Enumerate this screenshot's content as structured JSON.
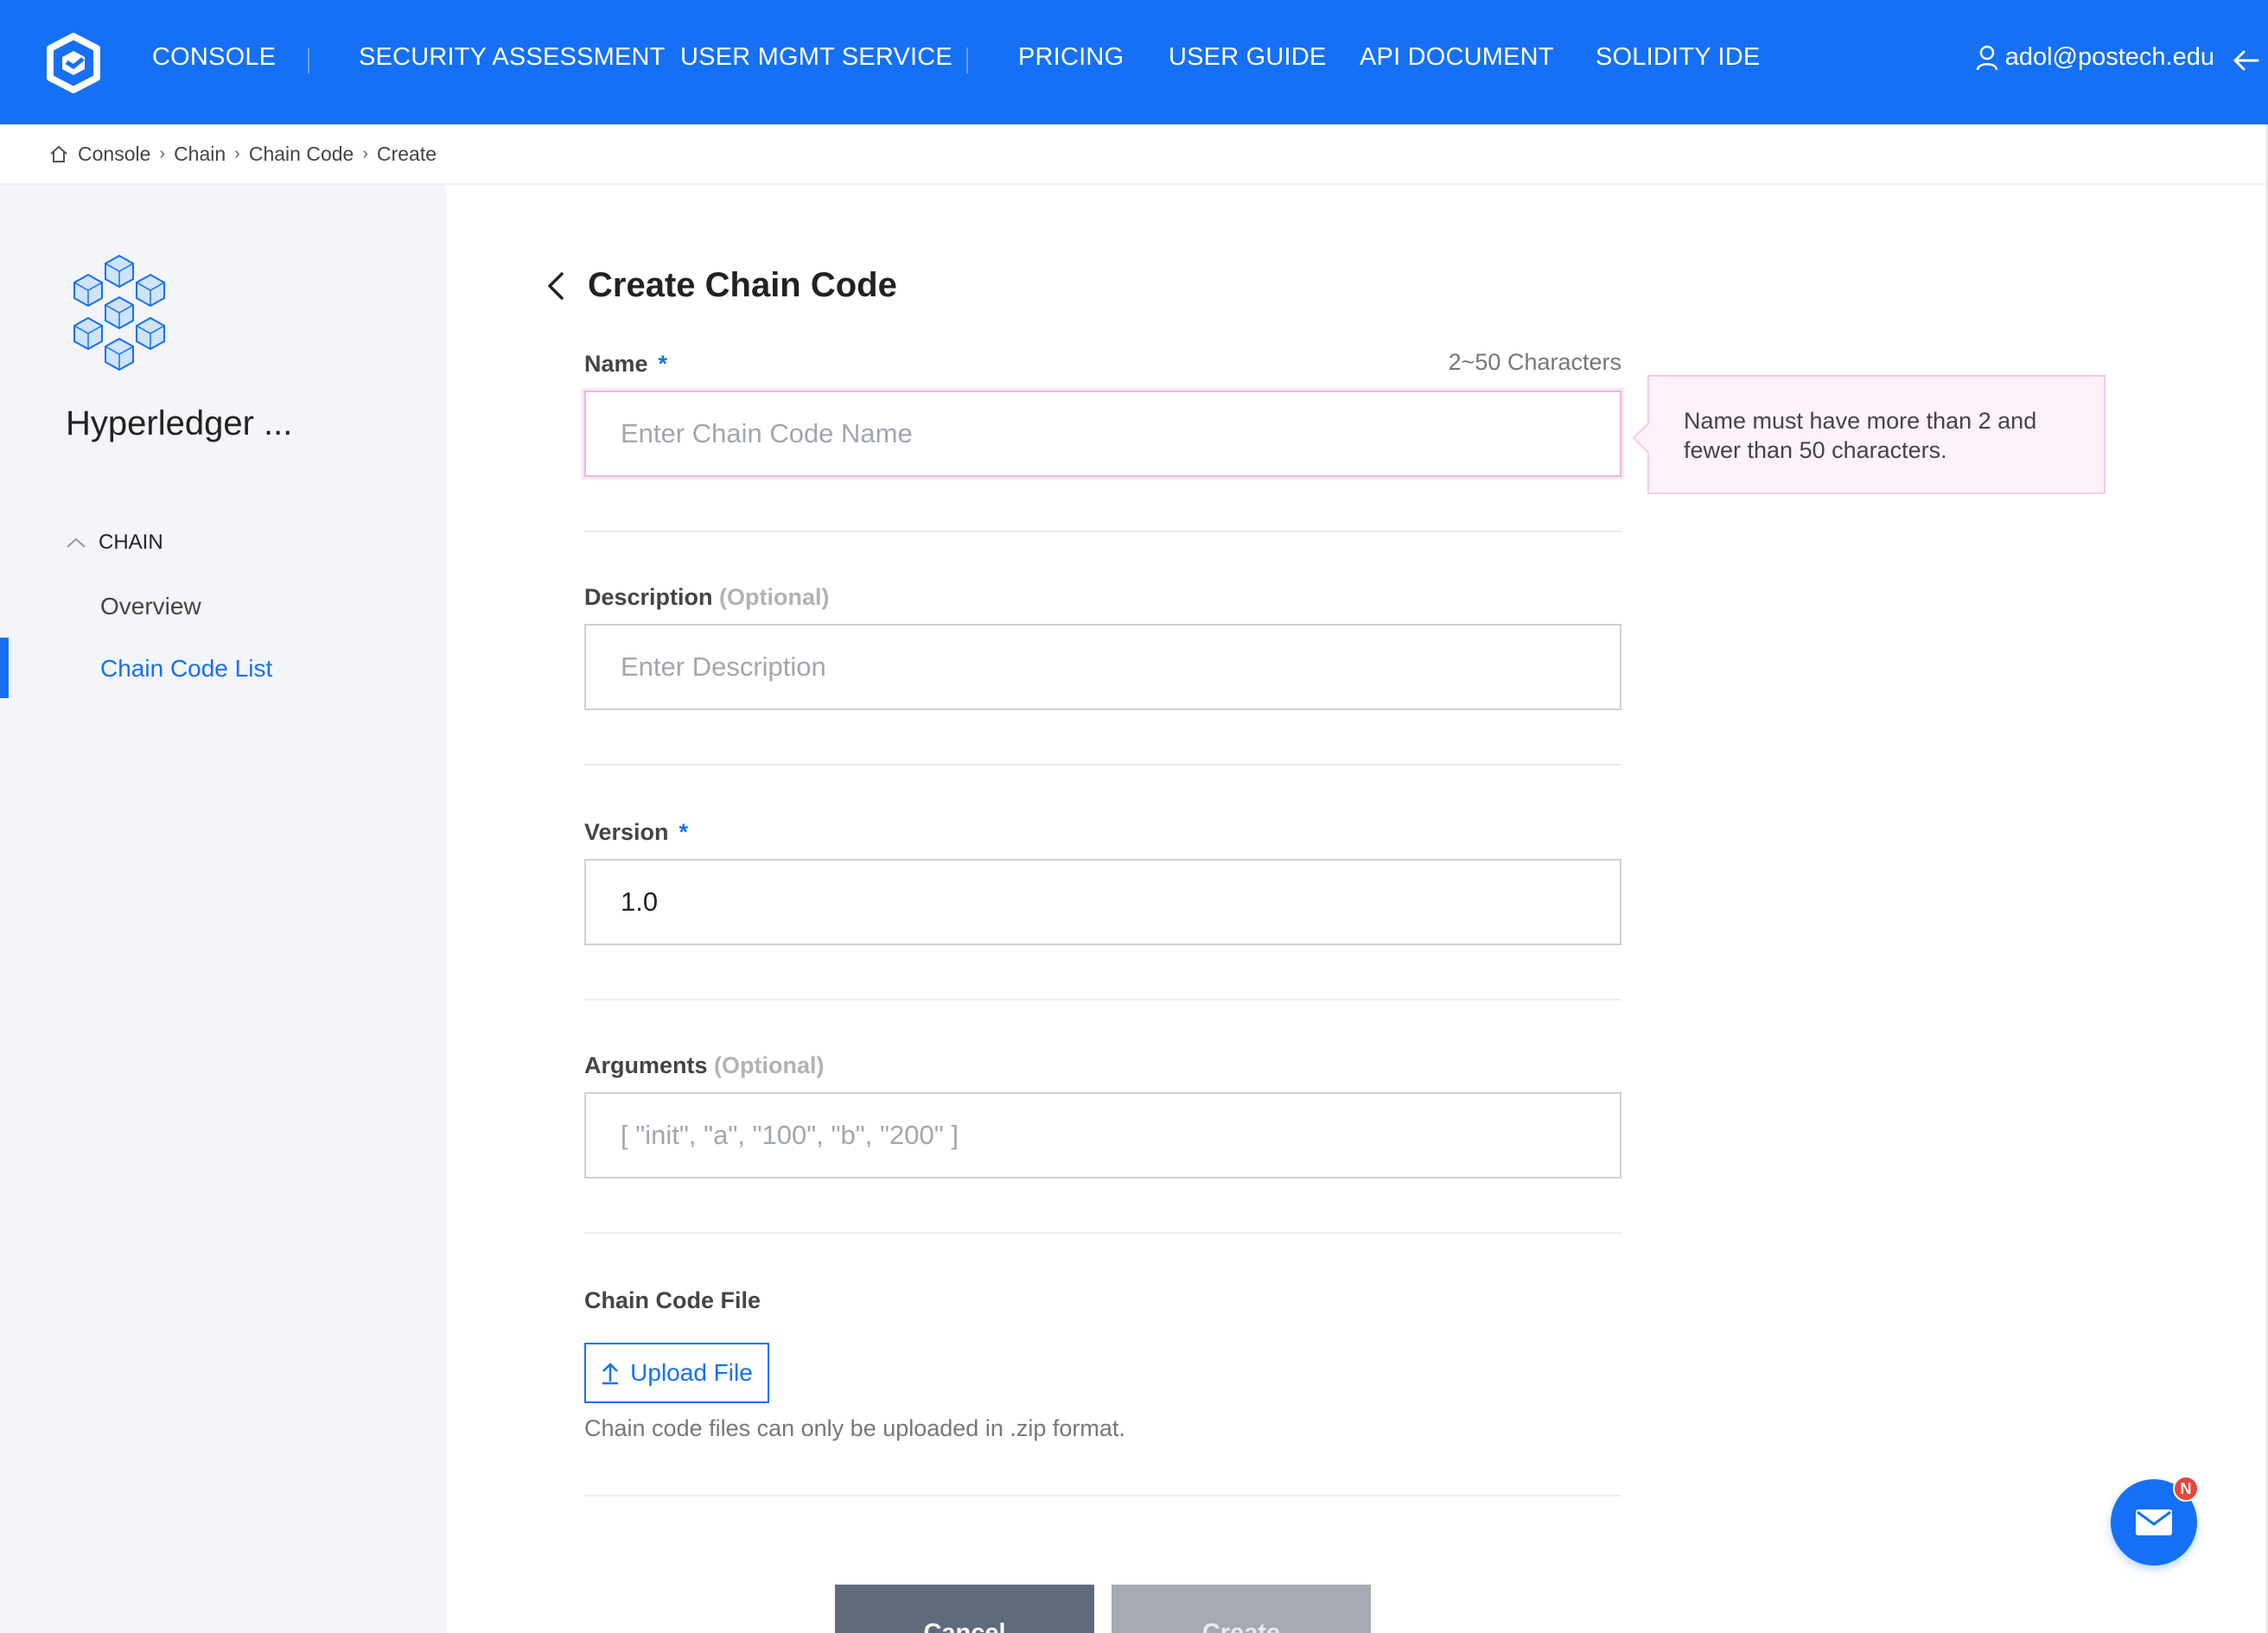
{
  "nav": {
    "items": [
      "CONSOLE",
      "SECURITY ASSESSMENT",
      "USER MGMT SERVICE",
      "PRICING",
      "USER GUIDE",
      "API DOCUMENT",
      "SOLIDITY IDE"
    ],
    "user_email": "adol@postech.edu",
    "brand_color": "#1570f5"
  },
  "breadcrumb": {
    "items": [
      "Console",
      "Chain",
      "Chain Code",
      "Create"
    ]
  },
  "sidebar": {
    "project_name": "Hyperledger ...",
    "section": "CHAIN",
    "links": [
      "Overview",
      "Chain Code List"
    ],
    "active_link": "Chain Code List"
  },
  "form": {
    "title": "Create Chain Code",
    "name": {
      "label": "Name",
      "required_mark": "*",
      "hint": "2~50 Characters",
      "placeholder": "Enter Chain Code Name",
      "value": "",
      "error_tooltip": "Name must have more than 2 and fewer than 50 characters."
    },
    "description": {
      "label": "Description",
      "optional": "(Optional)",
      "placeholder": "Enter Description",
      "value": ""
    },
    "version": {
      "label": "Version",
      "required_mark": "*",
      "value": "1.0"
    },
    "arguments": {
      "label": "Arguments",
      "optional": "(Optional)",
      "placeholder": "[ \"init\", \"a\", \"100\", \"b\", \"200\" ]",
      "value": ""
    },
    "file": {
      "label": "Chain Code File",
      "upload_label": "Upload File",
      "note": "Chain code files can only be uploaded in .zip format."
    },
    "buttons": {
      "cancel": "Cancel",
      "create": "Create"
    }
  },
  "fab": {
    "badge": "N",
    "icon": "mail-icon"
  }
}
